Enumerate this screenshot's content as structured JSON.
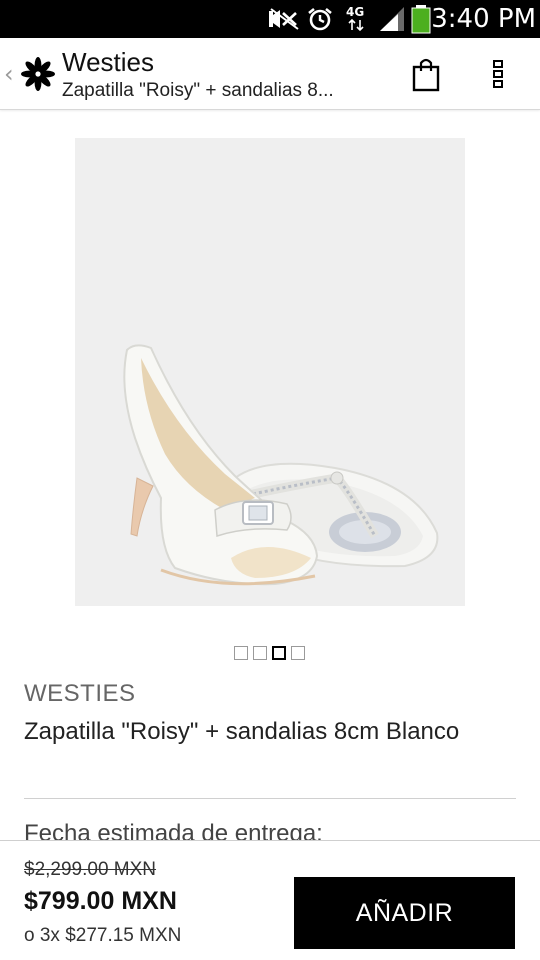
{
  "status_bar": {
    "time": "3:40 PM",
    "network": "4G",
    "icons": [
      "mute-icon",
      "alarm-icon",
      "network-4g-icon",
      "signal-icon",
      "battery-icon"
    ]
  },
  "action_bar": {
    "title": "Westies",
    "subtitle": "Zapatilla \"Roisy\" + sandalias 8...",
    "icons": [
      "up-caret-icon",
      "westies-logo-icon",
      "shopping-bag-icon",
      "overflow-menu-icon"
    ]
  },
  "gallery": {
    "page_count": 4,
    "active_index": 2
  },
  "product": {
    "brand": "WESTIES",
    "name": "Zapatilla \"Roisy\" + sandalias 8cm Blanco",
    "delivery_label": "Fecha estimada de entrega:"
  },
  "purchase": {
    "old_price": "$2,299.00 MXN",
    "price": "$799.00 MXN",
    "installments": "o 3x $277.15 MXN",
    "add_label": "AÑADIR"
  },
  "colors": {
    "status_bar": "#000000",
    "button": "#000000",
    "image_bg": "#efefef"
  }
}
